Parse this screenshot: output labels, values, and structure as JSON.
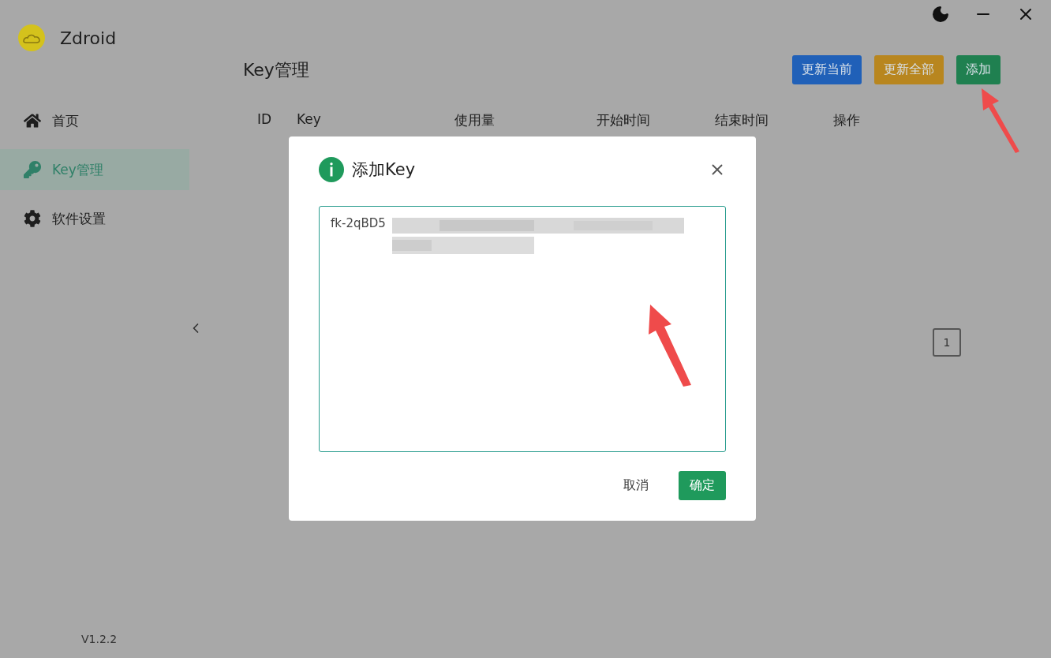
{
  "app": {
    "name": "Zdroid",
    "version": "V1.2.2"
  },
  "sidebar": {
    "items": [
      {
        "label": "首页",
        "kind": "home",
        "selected": false
      },
      {
        "label": "Key管理",
        "kind": "key",
        "selected": true
      },
      {
        "label": "软件设置",
        "kind": "settings",
        "selected": false
      }
    ]
  },
  "page": {
    "title": "Key管理",
    "buttons": [
      {
        "label": "更新当前",
        "color": "#2060b8"
      },
      {
        "label": "更新全部",
        "color": "#b8861f"
      },
      {
        "label": "添加",
        "color": "#1f8050"
      }
    ],
    "table": {
      "columns": [
        "ID",
        "Key",
        "使用量",
        "开始时间",
        "结束时间",
        "操作"
      ]
    },
    "pagination": {
      "pages": [
        {
          "label": "1",
          "selected": true
        }
      ]
    }
  },
  "dialog": {
    "title": "添加Key",
    "value": "fk-2qBD5",
    "buttons": [
      {
        "label": "取消",
        "kind": "text"
      },
      {
        "label": "确定",
        "kind": "primary"
      }
    ]
  }
}
